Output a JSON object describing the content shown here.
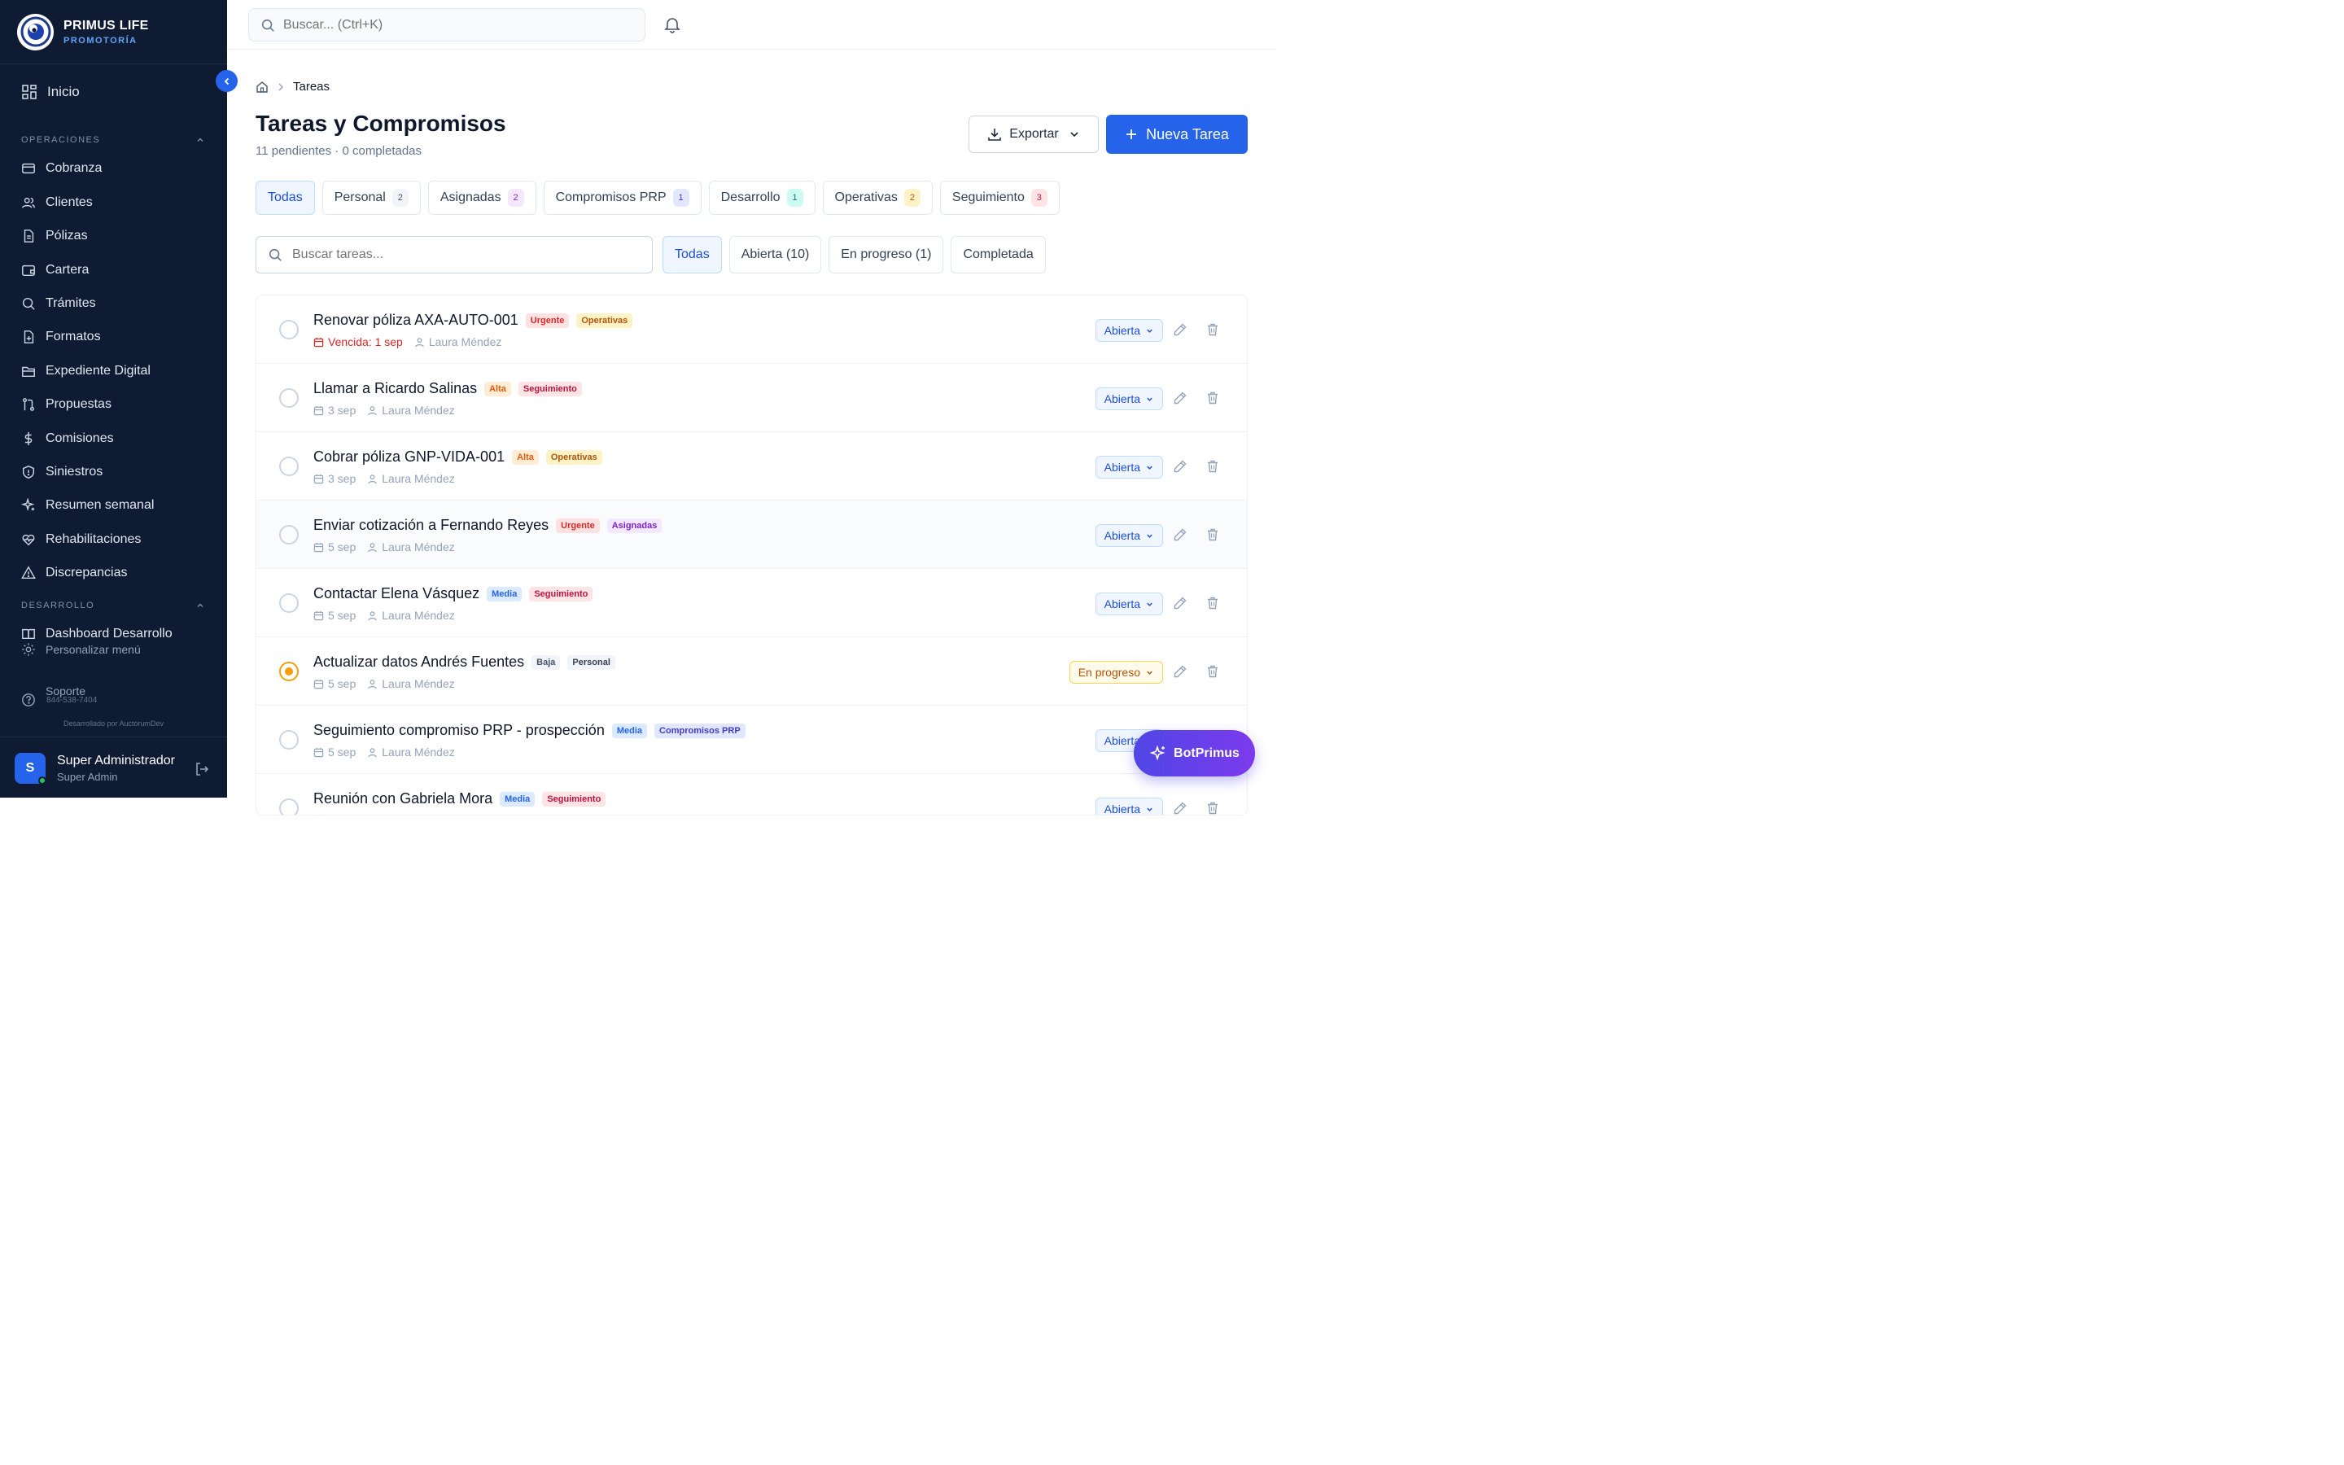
{
  "brand": {
    "name": "PRIMUS LIFE",
    "sub": "PROMOTORÍA"
  },
  "sidebar": {
    "home": "Inicio",
    "section_ops": "OPERACIONES",
    "ops": [
      "Cobranza",
      "Clientes",
      "Pólizas",
      "Cartera",
      "Trámites",
      "Formatos",
      "Expediente Digital",
      "Propuestas",
      "Comisiones",
      "Siniestros",
      "Resumen semanal",
      "Rehabilitaciones",
      "Discrepancias"
    ],
    "section_dev": "DESARROLLO",
    "dev_partial": "Dashboard Desarrollo",
    "customize": "Personalizar menú",
    "support": "Soporte",
    "phone": "844-538-7404",
    "credit": "Desarrollado por AuctorumDev",
    "user_initial": "S",
    "user_name": "Super Administrador",
    "user_role": "Super Admin"
  },
  "topbar": {
    "search_placeholder": "Buscar... (Ctrl+K)"
  },
  "page": {
    "breadcrumb": "Tareas",
    "title": "Tareas y Compromisos",
    "subtitle": "11 pendientes · 0 completadas",
    "export_label": "Exportar",
    "new_label": "Nueva Tarea"
  },
  "tabs": [
    {
      "label": "Todas",
      "count": ""
    },
    {
      "label": "Personal",
      "count": "2"
    },
    {
      "label": "Asignadas",
      "count": "2"
    },
    {
      "label": "Compromisos PRP",
      "count": "1"
    },
    {
      "label": "Desarrollo",
      "count": "1"
    },
    {
      "label": "Operativas",
      "count": "2"
    },
    {
      "label": "Seguimiento",
      "count": "3"
    }
  ],
  "task_search_placeholder": "Buscar tareas...",
  "filters": [
    "Todas",
    "Abierta (10)",
    "En progreso (1)",
    "Completada"
  ],
  "tasks": [
    {
      "title": "Renovar póliza AXA-AUTO-001",
      "priority": "Urgente",
      "category": "Operativas",
      "date": "Vencida: 1 sep",
      "assignee": "Laura Méndez",
      "status": "Abierta"
    },
    {
      "title": "Llamar a Ricardo Salinas",
      "priority": "Alta",
      "category": "Seguimiento",
      "date": "3 sep",
      "assignee": "Laura Méndez",
      "status": "Abierta"
    },
    {
      "title": "Cobrar póliza GNP-VIDA-001",
      "priority": "Alta",
      "category": "Operativas",
      "date": "3 sep",
      "assignee": "Laura Méndez",
      "status": "Abierta"
    },
    {
      "title": "Enviar cotización a Fernando Reyes",
      "priority": "Urgente",
      "category": "Asignadas",
      "date": "5 sep",
      "assignee": "Laura Méndez",
      "status": "Abierta"
    },
    {
      "title": "Contactar Elena Vásquez",
      "priority": "Media",
      "category": "Seguimiento",
      "date": "5 sep",
      "assignee": "Laura Méndez",
      "status": "Abierta"
    },
    {
      "title": "Actualizar datos Andrés Fuentes",
      "priority": "Baja",
      "category": "Personal",
      "date": "5 sep",
      "assignee": "Laura Méndez",
      "status": "En progreso"
    },
    {
      "title": "Seguimiento compromiso PRP - prospección",
      "priority": "Media",
      "category": "Compromisos PRP",
      "date": "5 sep",
      "assignee": "Laura Méndez",
      "status": "Abierta"
    },
    {
      "title": "Reunión con Gabriela Mora",
      "priority": "Media",
      "category": "Seguimiento",
      "date": "",
      "assignee": "",
      "status": "Abierta"
    }
  ],
  "bot_label": "BotPrimus",
  "colors": {
    "sidebar": "#0f1a33",
    "accent": "#2563eb",
    "urgent": "#dc2626",
    "progress": "#f59e0b"
  }
}
